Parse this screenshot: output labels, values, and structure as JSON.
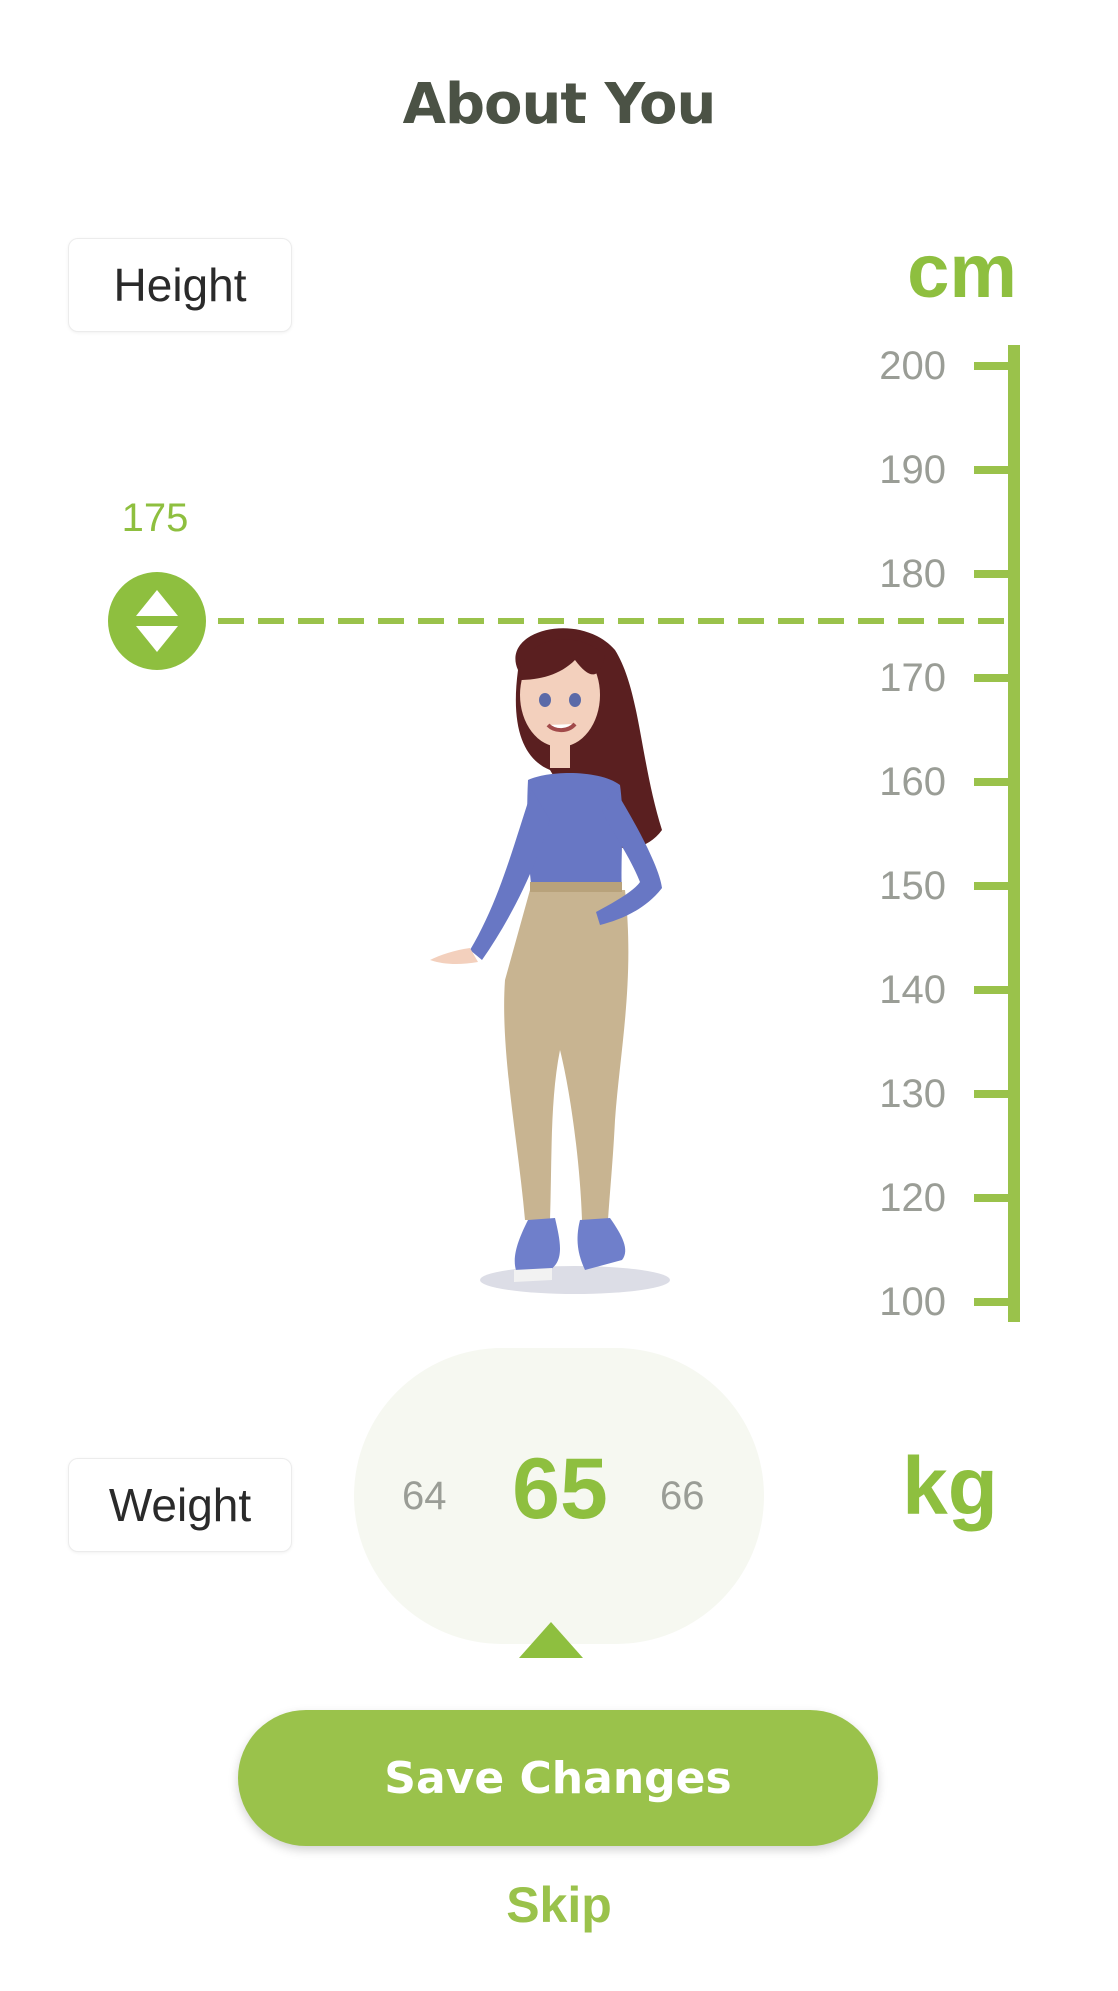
{
  "page_title": "About You",
  "height": {
    "label": "Height",
    "unit": "cm",
    "selected_value": "175",
    "ruler_ticks": [
      "200",
      "190",
      "180",
      "170",
      "160",
      "150",
      "140",
      "130",
      "120",
      "100"
    ]
  },
  "weight": {
    "label": "Weight",
    "unit": "kg",
    "previous": "64",
    "selected": "65",
    "next": "66"
  },
  "actions": {
    "save_label": "Save Changes",
    "skip_label": "Skip"
  },
  "colors": {
    "accent": "#9ac24b",
    "title": "#4b5245",
    "tick_text": "#9a9d96"
  },
  "icons": {
    "height_handle": "up-down-arrows-icon",
    "weight_pointer": "triangle-up-icon"
  }
}
